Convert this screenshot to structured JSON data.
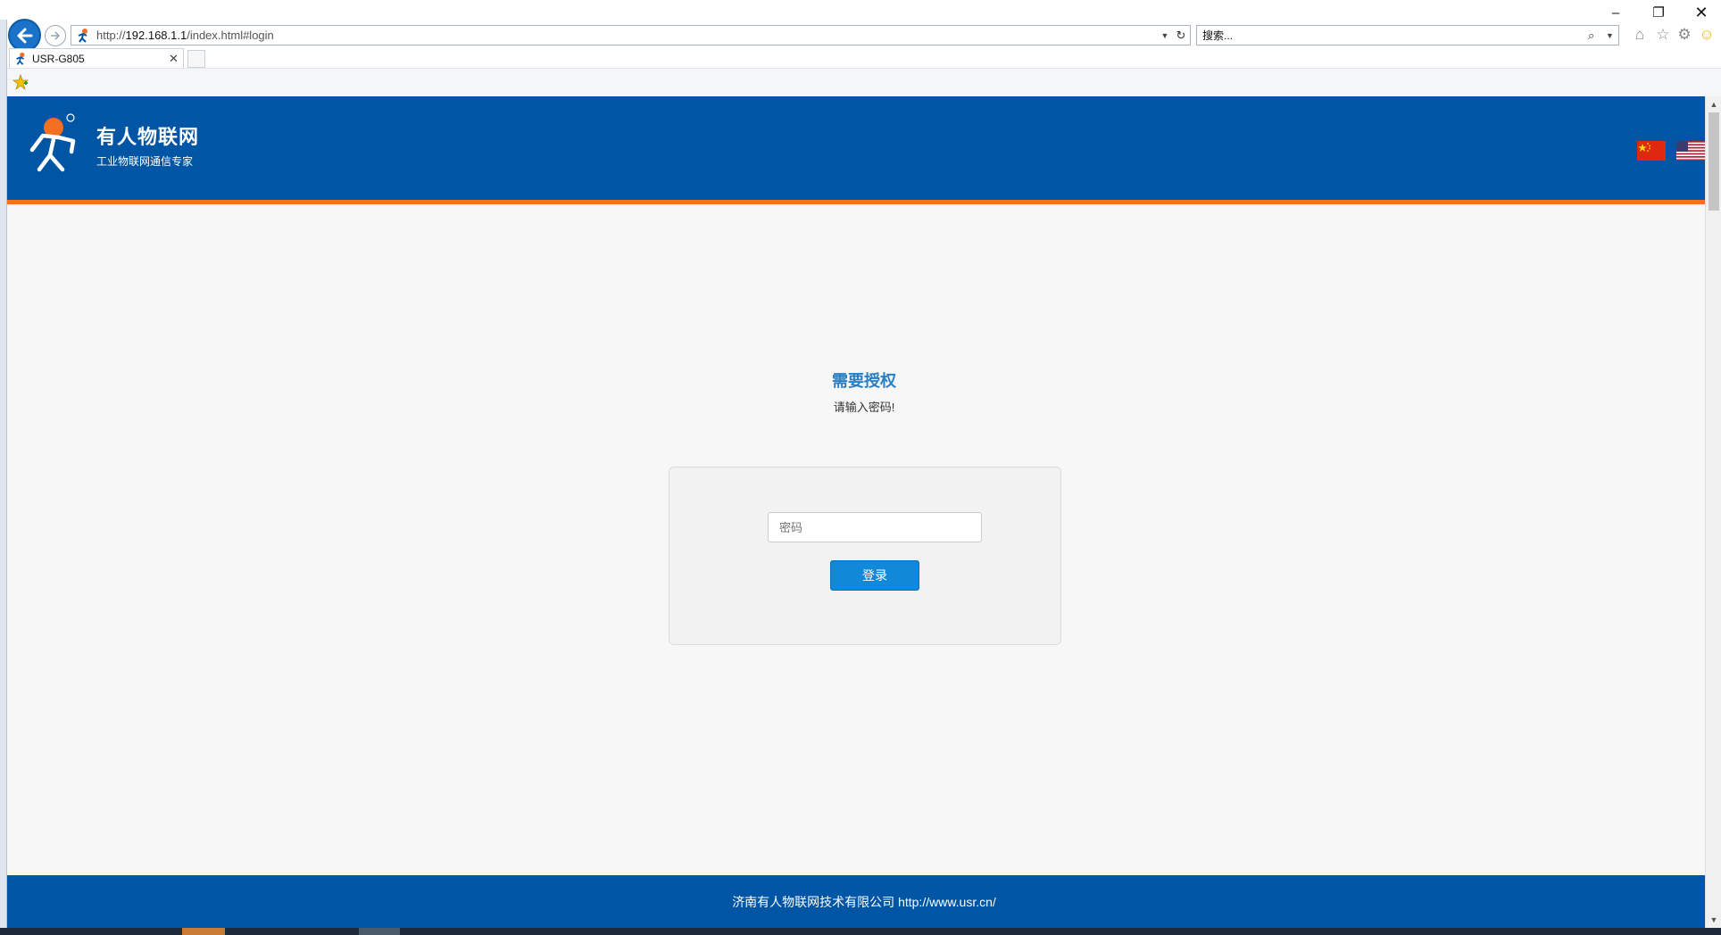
{
  "browser": {
    "url_prefix": "http://",
    "url_host": "192.168.1.1",
    "url_path": "/index.html#login",
    "search_placeholder": "搜索...",
    "tab_title": "USR-G805",
    "window_controls": {
      "minimize": "–",
      "restore": "❐",
      "close": "✕"
    }
  },
  "header": {
    "brand": "有人物联网",
    "slogan": "工业物联网通信专家"
  },
  "login": {
    "title": "需要授权",
    "subtitle": "请输入密码!",
    "password_placeholder": "密码",
    "submit_label": "登录"
  },
  "footer": {
    "text": "济南有人物联网技术有限公司  http://www.usr.cn/"
  },
  "colors": {
    "header_bg": "#0055a5",
    "header_stripe": "#f36f21",
    "title_blue": "#2a7fc4",
    "button_blue": "#1188d8"
  },
  "icons": {
    "back": "arrow-left-icon",
    "forward": "arrow-right-icon",
    "refresh": "refresh-icon",
    "search": "search-icon",
    "home": "home-icon",
    "favorites": "star-icon",
    "settings": "gear-icon",
    "feedback": "smiley-icon",
    "flag_cn": "china-flag-icon",
    "flag_us": "us-flag-icon"
  }
}
